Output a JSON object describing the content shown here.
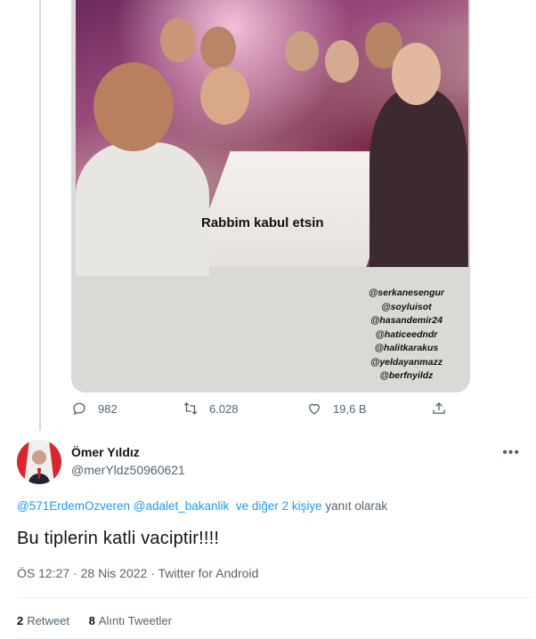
{
  "media": {
    "story_caption": "Rabbim kabul etsin",
    "tags": [
      "@serkanesengur",
      "@soyluisot",
      "@hasandemir24",
      "@haticeedndr",
      "@halitkarakus",
      "@yeldayanmazz",
      "@berfnyildz"
    ]
  },
  "actions": {
    "replies": "982",
    "retweets": "6.028",
    "likes": "19,6 B",
    "icons": [
      "reply-icon",
      "retweet-icon",
      "like-icon",
      "share-icon"
    ]
  },
  "tweet": {
    "author_name": "Ömer Yıldız",
    "author_handle": "@merYldz50960621",
    "reply_to_1": "@571ErdemOzveren",
    "reply_to_2": "@adalet_bakanlik",
    "reply_to_others": "ve diğer 2 kişiye",
    "reply_suffix": "yanıt olarak",
    "text": "Bu tiplerin katli vaciptir!!!!",
    "time": "ÖS 12:27",
    "date": "28 Nis 2022",
    "source": "Twitter for Android",
    "separator": "·",
    "retweet_count": "2",
    "retweet_label": "Retweet",
    "quote_count": "8",
    "quote_label": "Alıntı Tweetler"
  },
  "colors": {
    "link": "#1d9bf0",
    "muted": "#536471",
    "text": "#0f1419"
  }
}
